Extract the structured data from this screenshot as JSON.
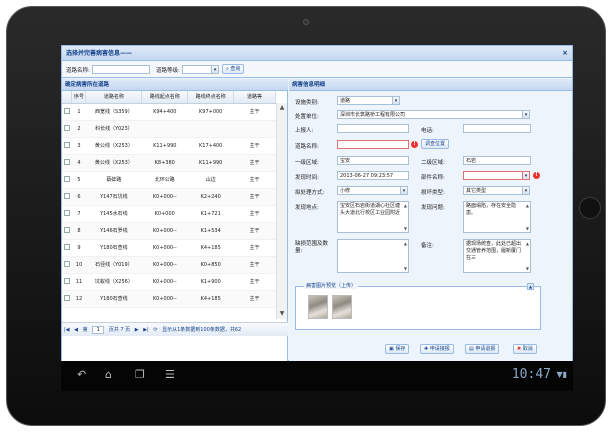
{
  "window": {
    "title": "选择并完善病害信息——",
    "close": "×"
  },
  "search": {
    "road_label": "道路名称:",
    "road_value": "",
    "grade_label": "道路等级:",
    "grade_value": "",
    "query_btn": "查询"
  },
  "left": {
    "title": "确定病害所在道路",
    "columns": [
      "序号",
      "道路名称",
      "路线起点名称",
      "路线终点名称",
      "道路等"
    ],
    "rows": [
      {
        "no": "1",
        "name": "西宽线（S359）",
        "start": "K94+400",
        "end": "K97+000",
        "grade": "主干"
      },
      {
        "no": "2",
        "name": "科长线（Y023）",
        "start": "",
        "end": "",
        "grade": ""
      },
      {
        "no": "3",
        "name": "黄公线（X253）",
        "start": "K11+990",
        "end": "K17+400",
        "grade": "主干"
      },
      {
        "no": "4",
        "name": "黄公线（X253）",
        "start": "K8+380",
        "end": "K11+990",
        "grade": "主干"
      },
      {
        "no": "5",
        "name": "蔡蚌路",
        "start": "北环公路",
        "end": "山边",
        "grade": "主干"
      },
      {
        "no": "6",
        "name": "Y147石坑线",
        "start": "K0+000--",
        "end": "K2+240",
        "grade": "主干"
      },
      {
        "no": "7",
        "name": "Y145水石线",
        "start": "K0+000",
        "end": "K1+721",
        "grade": "主干"
      },
      {
        "no": "8",
        "name": "Y146石罗线",
        "start": "K0+000--",
        "end": "K1+534",
        "grade": "主干"
      },
      {
        "no": "9",
        "name": "Y180石查线",
        "start": "K0+000--",
        "end": "K4+185",
        "grade": "主干"
      },
      {
        "no": "10",
        "name": "石径线（Y019）",
        "start": "K0+000--",
        "end": "K0+850",
        "grade": "主干"
      },
      {
        "no": "11",
        "name": "坑蚁线（X256）",
        "start": "K0+000--",
        "end": "K1+900",
        "grade": "主干"
      },
      {
        "no": "12",
        "name": "Y180石查线",
        "start": "K0+000--",
        "end": "K4+185",
        "grade": "主干"
      }
    ],
    "pager": {
      "page_label": "第",
      "page_value": "1",
      "page_total": "页共 7 页",
      "info": "显示从1条数据到100条数据，共62"
    }
  },
  "right": {
    "title": "病害信息明细",
    "category_label": "设施类别:",
    "category_value": "道路",
    "unit_label": "处置单位:",
    "unit_value": "深圳市长筑路桥工程有限公司",
    "reporter_label": "上报人:",
    "reporter_value": "",
    "phone_label": "电话:",
    "phone_value": "",
    "road_label": "道路名称:",
    "road_value": "",
    "locate_btn": "调查位置",
    "area1_label": "一级区域:",
    "area1_value": "宝安",
    "area2_label": "二级区域:",
    "area2_value": "石岩",
    "time_label": "发现时间:",
    "time_value": "2013-06-27 09:23:57",
    "part_label": "部件名称:",
    "part_value": "",
    "method_label": "拟处理方式:",
    "method_value": "小修",
    "damage_label": "损坏类型:",
    "damage_value": "其它类型",
    "place_label": "发现地点:",
    "place_value": "宝安区石岩街道湖心社区塘头大道北行校区工业园附近",
    "problem_label": "发现问题:",
    "problem_value": "路面塌陷，存在安全隐患。",
    "extent_label": "缺损范围及数量:",
    "extent_value": "",
    "remark_label": "备注:",
    "remark_value": "据现场统查，此处已超出交通管养范围，履新厦门在三",
    "photos_label": "病害图片预览（上传）",
    "actions": {
      "save": "保存",
      "report": "申请接报",
      "cancel_report": "申请退报",
      "cancel": "取消"
    }
  },
  "tablet": {
    "clock": "10:47"
  },
  "colors": {
    "accent": "#15428b",
    "border": "#99bbe8",
    "panel_bg": "#eef4fb"
  }
}
